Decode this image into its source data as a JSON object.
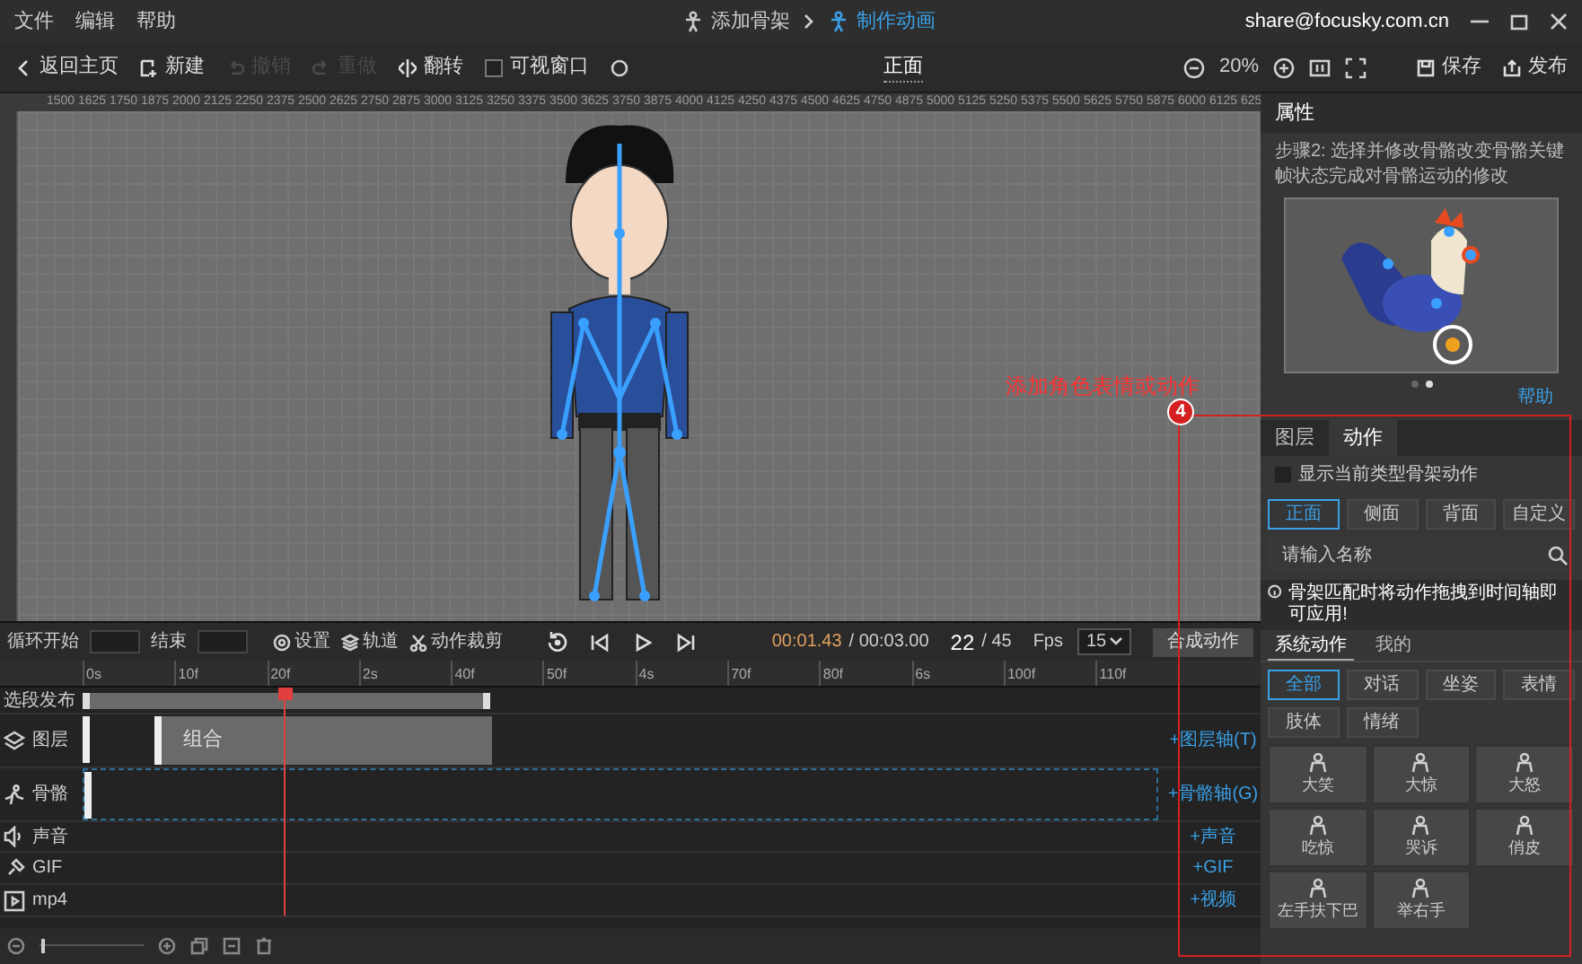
{
  "menu": [
    "文件",
    "编辑",
    "帮助"
  ],
  "steps": [
    {
      "label": "添加骨架",
      "selected": false
    },
    {
      "label": "制作动画",
      "selected": true
    }
  ],
  "account": "share@focusky.com.cn",
  "toolbar": {
    "left": [
      {
        "kind": "back",
        "label": "返回主页",
        "disabled": false
      },
      {
        "kind": "new",
        "label": "新建",
        "disabled": false
      },
      {
        "kind": "undo",
        "label": "撤销",
        "disabled": true
      },
      {
        "kind": "redo",
        "label": "重做",
        "disabled": true
      },
      {
        "kind": "flip",
        "label": "翻转",
        "disabled": false
      }
    ],
    "visible_window": {
      "label": "可视窗口",
      "checked": false
    },
    "view": "正面",
    "zoom": "20%",
    "right": [
      {
        "kind": "save",
        "label": "保存"
      },
      {
        "kind": "publish",
        "label": "发布"
      }
    ]
  },
  "canvas": {
    "ruler_labels": [
      "1500",
      "1625",
      "1750",
      "1875",
      "2000",
      "2125",
      "2250",
      "2375",
      "2500",
      "2625",
      "2750",
      "2875",
      "3000",
      "3125",
      "3250",
      "3375",
      "3500",
      "3625",
      "3750",
      "3875",
      "4000",
      "4125",
      "4250",
      "4375",
      "4500",
      "4625",
      "4750",
      "4875",
      "5000",
      "5125",
      "5250",
      "5375",
      "5500",
      "5625",
      "5750",
      "5875",
      "6000",
      "6125",
      "625"
    ]
  },
  "annotation": {
    "text": "添加角色表情或动作",
    "number": "4"
  },
  "properties": {
    "title": "属性",
    "step_text": "步骤2: 选择并修改骨骼改变骨骼关键帧状态完成对骨骼运动的修改",
    "dots": [
      {
        "selected": false
      },
      {
        "selected": true
      }
    ],
    "help": "帮助"
  },
  "library": {
    "tabs": [
      {
        "label": "图层",
        "selected": false
      },
      {
        "label": "动作",
        "selected": true
      }
    ],
    "show_type": {
      "label": "显示当前类型骨架动作",
      "checked": false
    },
    "views": [
      {
        "label": "正面",
        "selected": true
      },
      {
        "label": "侧面",
        "selected": false
      },
      {
        "label": "背面",
        "selected": false
      },
      {
        "label": "自定义",
        "selected": false
      }
    ],
    "search": {
      "placeholder": "请输入名称"
    },
    "info": "骨架匹配时将动作拖拽到时间轴即可应用!",
    "source_tabs": [
      {
        "label": "系统动作",
        "selected": true
      },
      {
        "label": "我的",
        "selected": false
      }
    ],
    "categories": [
      {
        "label": "全部",
        "selected": true
      },
      {
        "label": "对话",
        "selected": false
      },
      {
        "label": "坐姿",
        "selected": false
      },
      {
        "label": "表情",
        "selected": false
      },
      {
        "label": "肢体",
        "selected": false
      },
      {
        "label": "情绪",
        "selected": false
      }
    ],
    "actions": [
      "大笑",
      "大惊",
      "大怒",
      "吃惊",
      "哭诉",
      "俏皮",
      "左手扶下巴",
      "举右手"
    ]
  },
  "timeline": {
    "loop_start": "循环开始",
    "end": "结束",
    "tools": [
      {
        "kind": "settings",
        "label": "设置"
      },
      {
        "kind": "track",
        "label": "轨道"
      },
      {
        "kind": "cut",
        "label": "动作裁剪"
      }
    ],
    "current_time": "00:01.43",
    "total_time": "/ 00:03.00",
    "frame": "22",
    "frame_total": "/ 45",
    "fps_label": "Fps",
    "fps": "15",
    "compose": "合成动作",
    "zoom_slider": {
      "level": 0.02
    },
    "ruler": [
      "0s",
      "10f",
      "20f",
      "2s",
      "40f",
      "50f",
      "4s",
      "70f",
      "80f",
      "6s",
      "100f",
      "110f"
    ],
    "tracks": [
      {
        "kind": "segment",
        "label": "选段发布"
      },
      {
        "kind": "layer",
        "label": "图层",
        "clip": "组合",
        "add": "+图层轴(T)"
      },
      {
        "kind": "bone",
        "label": "骨骼",
        "add": "+骨骼轴(G)"
      },
      {
        "kind": "sound",
        "label": "声音",
        "add": "+声音"
      },
      {
        "kind": "gif",
        "label": "GIF",
        "add": "+GIF"
      },
      {
        "kind": "video",
        "label": "mp4",
        "add": "+视频"
      }
    ]
  }
}
